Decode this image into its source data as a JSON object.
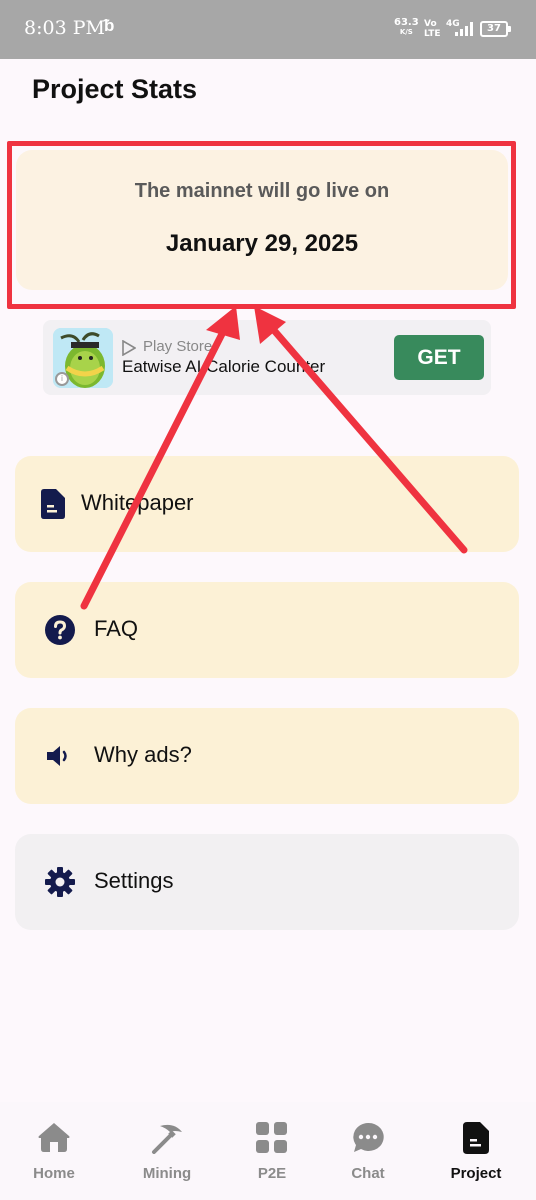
{
  "status_bar": {
    "time": "8:03 PM",
    "speed_value": "63.3",
    "speed_unit": "K/S",
    "volte": "Vo LTE",
    "network": "4G",
    "battery": "37"
  },
  "page": {
    "title": "Project Stats"
  },
  "mainnet": {
    "label": "The mainnet will go live on",
    "date": "January 29, 2025"
  },
  "ad": {
    "store": "Play Store",
    "app_name": "Eatwise AI Calorie Counter",
    "cta": "GET"
  },
  "menu": {
    "whitepaper": "Whitepaper",
    "faq": "FAQ",
    "why_ads": "Why ads?",
    "settings": "Settings"
  },
  "nav": {
    "home": "Home",
    "mining": "Mining",
    "p2e": "P2E",
    "chat": "Chat",
    "project": "Project",
    "active": "Project"
  },
  "colors": {
    "annotation_red": "#ef3340",
    "menu_bg": "#fcf1d6",
    "mainnet_bg": "#fcf2e2",
    "icon_navy": "#141b4d",
    "get_button": "#388a5c"
  }
}
